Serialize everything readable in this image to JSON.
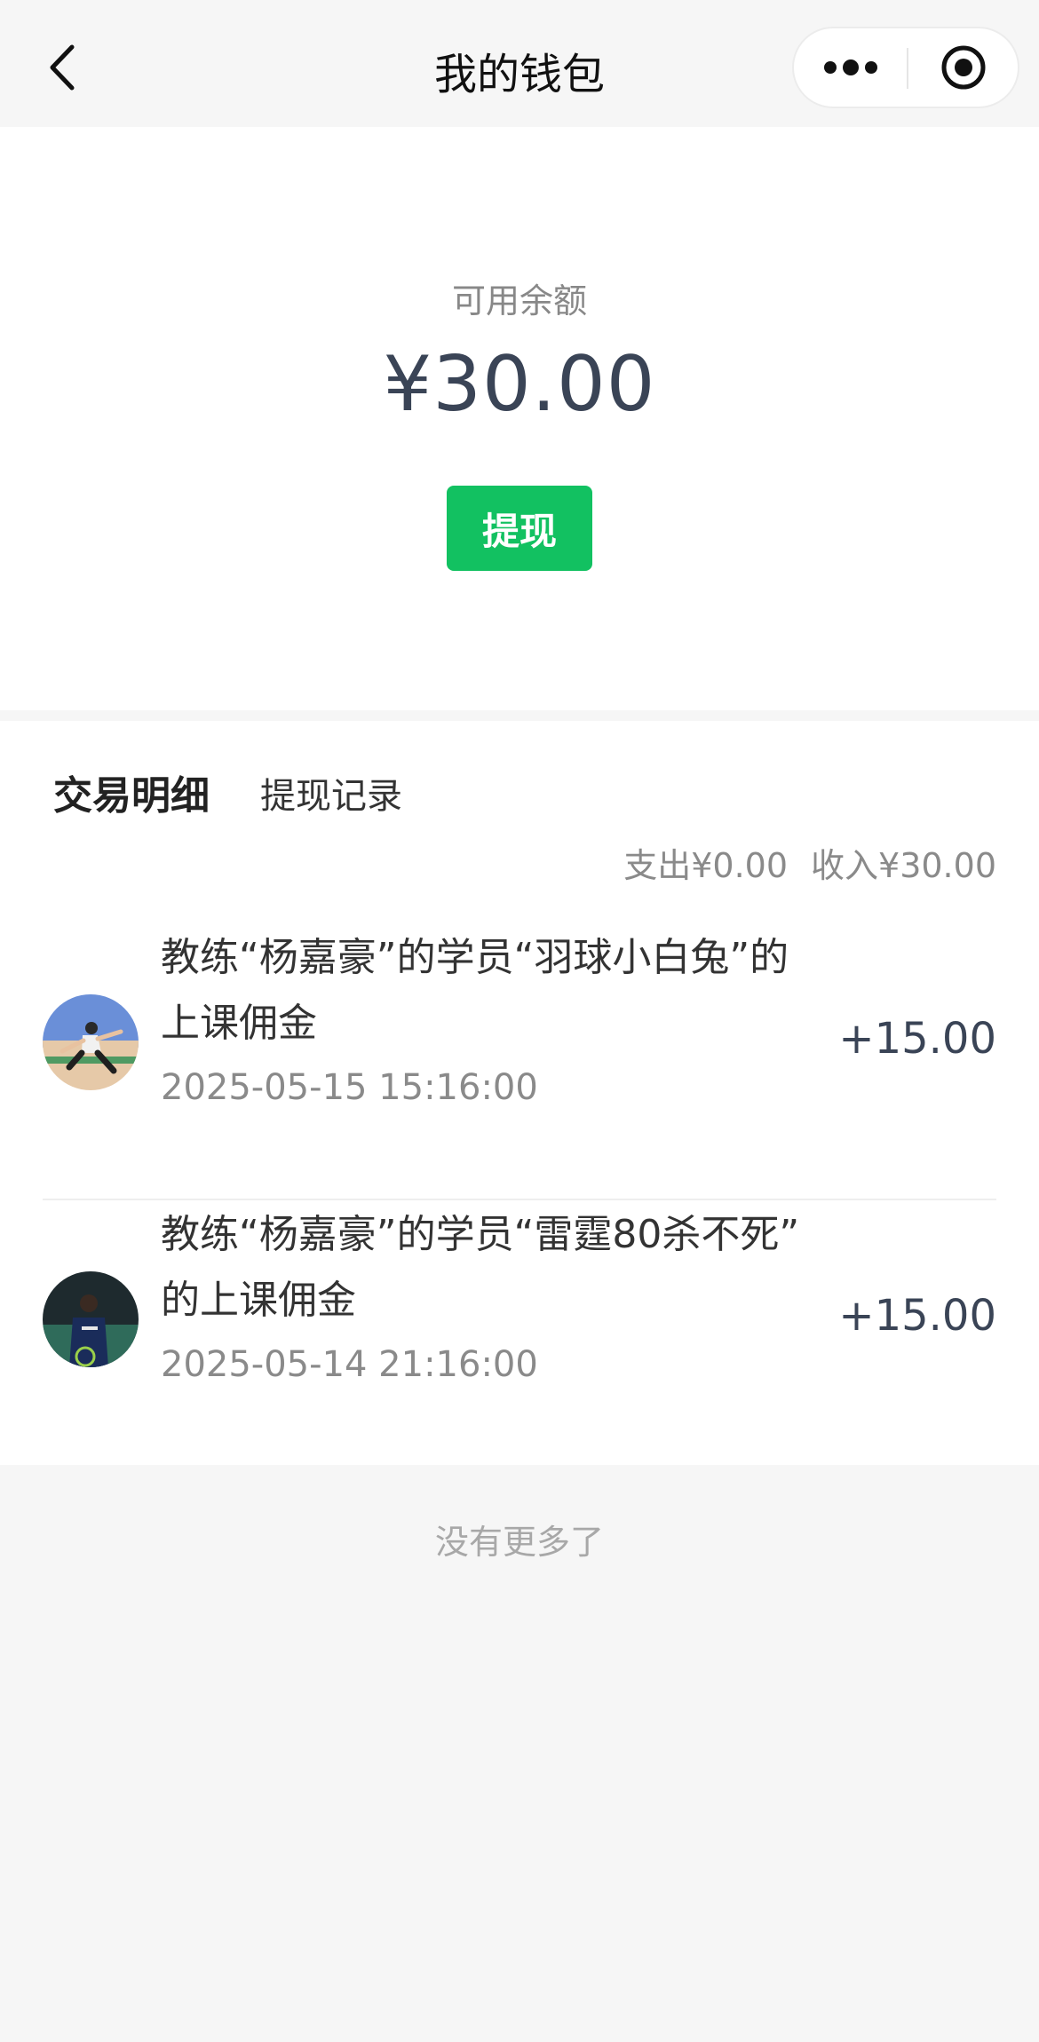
{
  "nav": {
    "title": "我的钱包",
    "back_icon": "chevron-left-icon",
    "more_icon": "more-dots-icon",
    "close_icon": "target-circle-icon"
  },
  "balance": {
    "label": "可用余额",
    "amount": "¥30.00",
    "withdraw_label": "提现"
  },
  "tabs": [
    {
      "label": "交易明细",
      "active": true
    },
    {
      "label": "提现记录",
      "active": false
    }
  ],
  "summary": {
    "expense": "支出¥0.00",
    "income": "收入¥30.00"
  },
  "transactions": [
    {
      "title_line1": "教练“杨嘉豪”的学员“羽球小白兔”的",
      "title_line2": "上课佣金",
      "time": "2025-05-15 15:16:00",
      "amount": "+15.00"
    },
    {
      "title_line1": "教练“杨嘉豪”的学员“雷霆80杀不死”",
      "title_line2": "的上课佣金",
      "time": "2025-05-14 21:16:00",
      "amount": "+15.00"
    }
  ],
  "footer": {
    "no_more": "没有更多了"
  },
  "colors": {
    "accent": "#12c161",
    "amount": "#3a4456",
    "page_bg": "#f6f6f6"
  }
}
